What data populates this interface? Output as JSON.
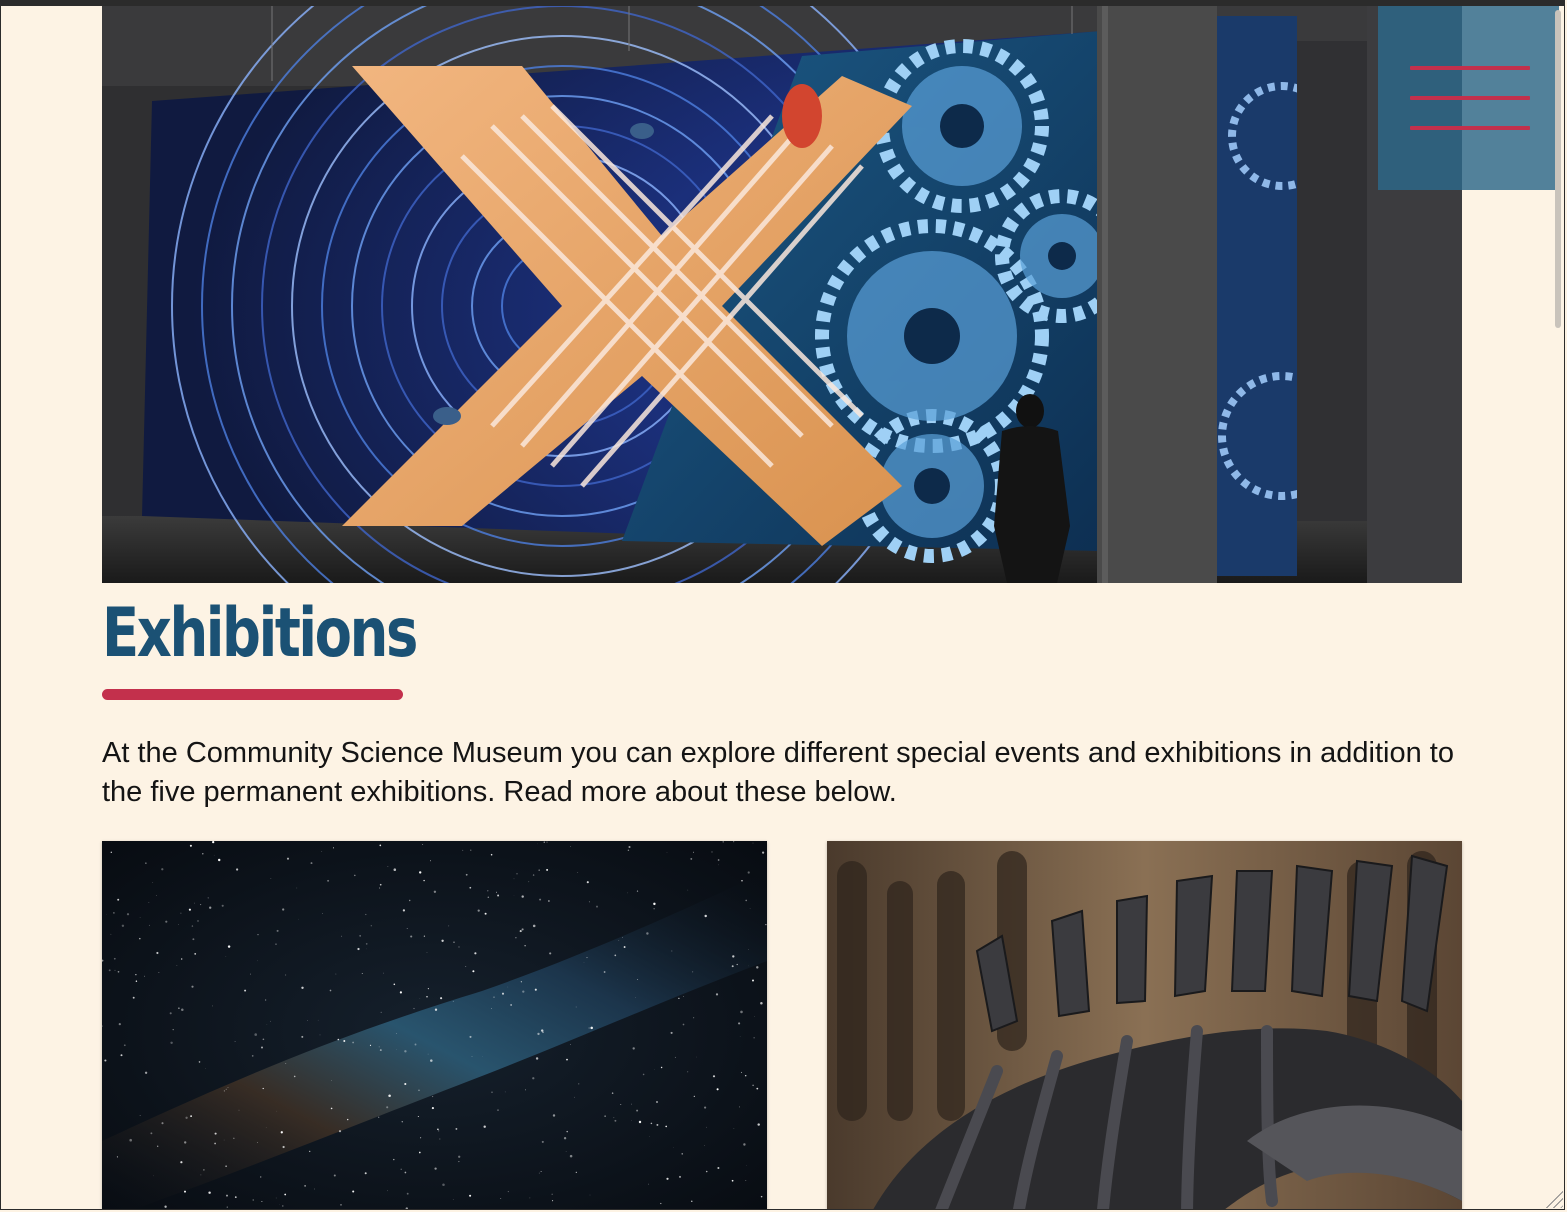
{
  "header": {
    "hero_image": "exhibition-hall-mural-photo",
    "menu_icon": "hamburger-menu-icon"
  },
  "main": {
    "title": "Exhibitions",
    "intro": "At the Community Science Museum you can explore different special events and exhibitions in addition to the five permanent exhibitions. Read more about these below.",
    "cards": [
      {
        "image": "milky-way-night-sky-photo"
      },
      {
        "image": "dinosaur-skeleton-photo"
      }
    ]
  },
  "colors": {
    "background": "#fdf3e4",
    "title": "#1b5174",
    "accent": "#c3304c",
    "menu_bg": "#2c688a"
  }
}
